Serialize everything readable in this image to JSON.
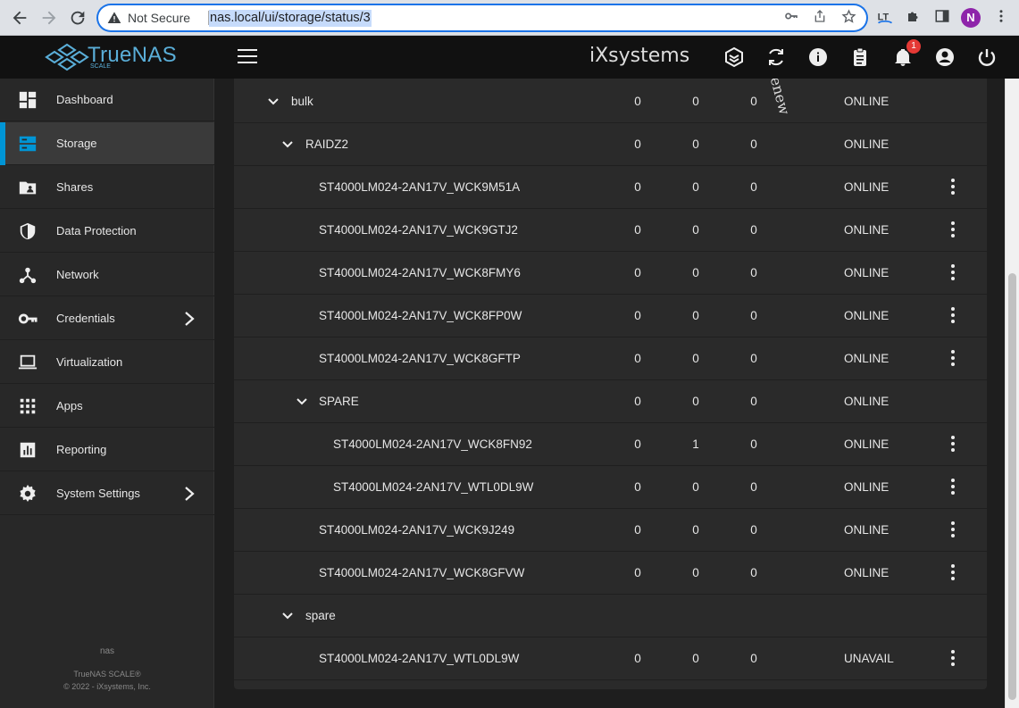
{
  "browser": {
    "security_label": "Not Secure",
    "url": "nas.local/ui/storage/status/3",
    "profile_initial": "N"
  },
  "app": {
    "brand": "TrueNAS",
    "brand_sub": "SCALE",
    "vendor": "iXsystems",
    "notification_count": "1"
  },
  "sidebar": {
    "items": [
      {
        "label": "Dashboard",
        "icon": "dashboard-icon"
      },
      {
        "label": "Storage",
        "icon": "storage-icon",
        "active": true
      },
      {
        "label": "Shares",
        "icon": "shares-icon"
      },
      {
        "label": "Data Protection",
        "icon": "shield-icon"
      },
      {
        "label": "Network",
        "icon": "network-icon"
      },
      {
        "label": "Credentials",
        "icon": "key-icon",
        "has_children": true
      },
      {
        "label": "Virtualization",
        "icon": "laptop-icon"
      },
      {
        "label": "Apps",
        "icon": "apps-grid-icon"
      },
      {
        "label": "Reporting",
        "icon": "chart-icon"
      },
      {
        "label": "System Settings",
        "icon": "gear-icon",
        "has_children": true
      }
    ],
    "hostname": "nas",
    "footer_product": "TrueNAS SCALE®",
    "footer_copyright": "© 2022 - iXsystems, Inc."
  },
  "overlay_text": "enew",
  "pool_rows": [
    {
      "name": "bulk",
      "level": 0,
      "expanded": true,
      "read": "0",
      "write": "0",
      "checksum": "0",
      "status": "ONLINE",
      "menu": false
    },
    {
      "name": "RAIDZ2",
      "level": 1,
      "expanded": true,
      "read": "0",
      "write": "0",
      "checksum": "0",
      "status": "ONLINE",
      "menu": false
    },
    {
      "name": "ST4000LM024-2AN17V_WCK9M51A",
      "level": 2,
      "read": "0",
      "write": "0",
      "checksum": "0",
      "status": "ONLINE",
      "menu": true
    },
    {
      "name": "ST4000LM024-2AN17V_WCK9GTJ2",
      "level": 2,
      "read": "0",
      "write": "0",
      "checksum": "0",
      "status": "ONLINE",
      "menu": true
    },
    {
      "name": "ST4000LM024-2AN17V_WCK8FMY6",
      "level": 2,
      "read": "0",
      "write": "0",
      "checksum": "0",
      "status": "ONLINE",
      "menu": true
    },
    {
      "name": "ST4000LM024-2AN17V_WCK8FP0W",
      "level": 2,
      "read": "0",
      "write": "0",
      "checksum": "0",
      "status": "ONLINE",
      "menu": true
    },
    {
      "name": "ST4000LM024-2AN17V_WCK8GFTP",
      "level": 2,
      "read": "0",
      "write": "0",
      "checksum": "0",
      "status": "ONLINE",
      "menu": true
    },
    {
      "name": "SPARE",
      "level": 2,
      "expanded": true,
      "read": "0",
      "write": "0",
      "checksum": "0",
      "status": "ONLINE",
      "menu": false
    },
    {
      "name": "ST4000LM024-2AN17V_WCK8FN92",
      "level": 3,
      "read": "0",
      "write": "1",
      "checksum": "0",
      "status": "ONLINE",
      "menu": true
    },
    {
      "name": "ST4000LM024-2AN17V_WTL0DL9W",
      "level": 3,
      "read": "0",
      "write": "0",
      "checksum": "0",
      "status": "ONLINE",
      "menu": true
    },
    {
      "name": "ST4000LM024-2AN17V_WCK9J249",
      "level": 2,
      "read": "0",
      "write": "0",
      "checksum": "0",
      "status": "ONLINE",
      "menu": true
    },
    {
      "name": "ST4000LM024-2AN17V_WCK8GFVW",
      "level": 2,
      "read": "0",
      "write": "0",
      "checksum": "0",
      "status": "ONLINE",
      "menu": true
    },
    {
      "name": "spare",
      "level": 1,
      "expanded": true,
      "read": "",
      "write": "",
      "checksum": "",
      "status": "",
      "menu": false
    },
    {
      "name": "ST4000LM024-2AN17V_WTL0DL9W",
      "level": 2,
      "read": "0",
      "write": "0",
      "checksum": "0",
      "status": "UNAVAIL",
      "menu": true
    }
  ]
}
